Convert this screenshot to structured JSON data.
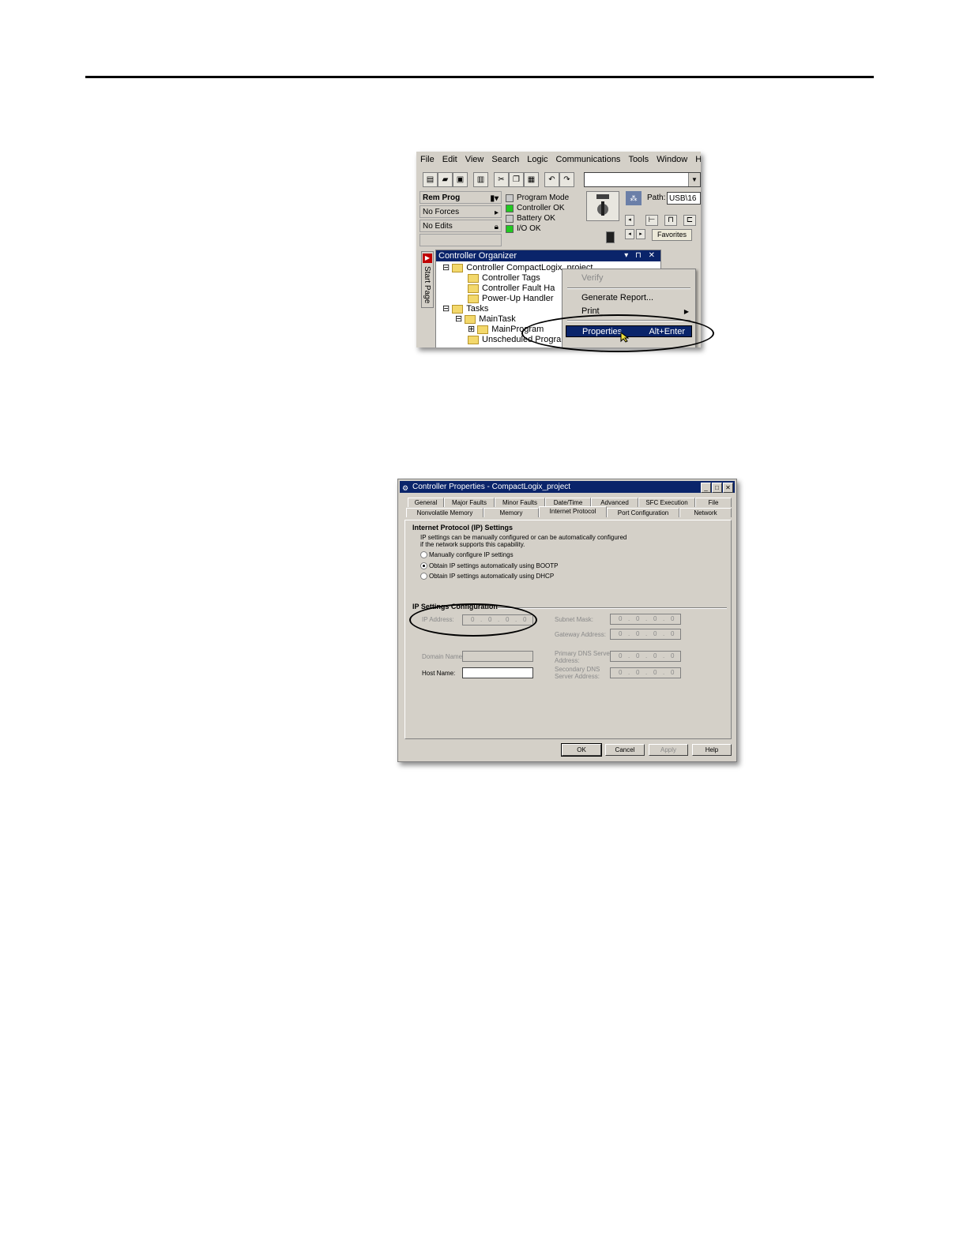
{
  "rslogix": {
    "menu": [
      "File",
      "Edit",
      "View",
      "Search",
      "Logic",
      "Communications",
      "Tools",
      "Window",
      "He"
    ],
    "status": {
      "mode": "Rem Prog",
      "forces": "No Forces",
      "edits": "No Edits"
    },
    "leds": [
      {
        "label": "Program Mode",
        "on": false
      },
      {
        "label": "Controller OK",
        "on": true
      },
      {
        "label": "Battery OK",
        "on": false
      },
      {
        "label": "I/O OK",
        "on": true
      }
    ],
    "path": {
      "label": "Path:",
      "value": "USB\\16"
    },
    "favorites_tab": "Favorites",
    "start_page": "Start Page",
    "organizer": {
      "title": "Controller Organizer",
      "header_buttons": "▾ ⊓ ✕",
      "tree": [
        "Controller CompactLogix_project",
        "Controller Tags",
        "Controller Fault Ha",
        "Power-Up Handler",
        "Tasks",
        "MainTask",
        "MainProgram",
        "Unscheduled Programs / Phases"
      ]
    },
    "context_menu": {
      "verify": "Verify",
      "generate_report": "Generate Report...",
      "print": "Print",
      "properties": "Properties",
      "properties_shortcut": "Alt+Enter"
    }
  },
  "dialog": {
    "title": "Controller Properties - CompactLogix_project",
    "tabs_row1": [
      "General",
      "Major Faults",
      "Minor Faults",
      "Date/Time",
      "Advanced",
      "SFC Execution",
      "File"
    ],
    "tabs_row2": [
      "Nonvolatile Memory",
      "Memory",
      "Internet Protocol",
      "Port Configuration",
      "Network"
    ],
    "active_tab": "Internet Protocol",
    "ip_section_title": "Internet Protocol (IP) Settings",
    "ip_description_1": "IP settings can be manually configured or can be automatically configured",
    "ip_description_2": "if the network supports this capability.",
    "radio_options": [
      {
        "label": "Manually configure IP settings",
        "selected": false
      },
      {
        "label": "Obtain IP settings automatically using BOOTP",
        "selected": true
      },
      {
        "label": "Obtain IP settings automatically using DHCP",
        "selected": false
      }
    ],
    "config_section_title": "IP Settings Configuration",
    "labels": {
      "ip_address": "IP Address:",
      "subnet_mask": "Subnet Mask:",
      "gateway_address": "Gateway Address:",
      "domain_name": "Domain Name:",
      "host_name": "Host Name:",
      "primary_dns_1": "Primary DNS Server",
      "primary_dns_2": "Address:",
      "secondary_dns_1": "Secondary DNS",
      "secondary_dns_2": "Server Address:"
    },
    "ip_octets": [
      "0",
      "0",
      "0",
      "0"
    ],
    "buttons": {
      "ok": "OK",
      "cancel": "Cancel",
      "apply": "Apply",
      "help": "Help"
    }
  }
}
